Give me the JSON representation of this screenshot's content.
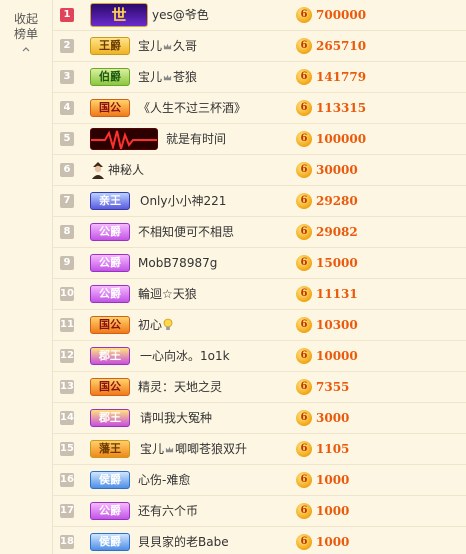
{
  "sidebar": {
    "collapse_label_1": "收起",
    "collapse_label_2": "榜单"
  },
  "rows": [
    {
      "rank": "1",
      "badge": "世",
      "name": "yes@爷色",
      "score": "700000"
    },
    {
      "rank": "2",
      "badge": "王爵",
      "name_a": "宝儿",
      "name_b": "久哥",
      "score": "265710"
    },
    {
      "rank": "3",
      "badge": "伯爵",
      "name_a": "宝儿",
      "name_b": "苍狼",
      "score": "141779"
    },
    {
      "rank": "4",
      "badge": "国公",
      "name": "《人生不过三杯酒》",
      "score": "113315"
    },
    {
      "rank": "5",
      "name": "就是有时间",
      "score": "100000"
    },
    {
      "rank": "6",
      "name": "神秘人",
      "score": "30000"
    },
    {
      "rank": "7",
      "badge": "亲王",
      "name": "Only小小神221",
      "score": "29280"
    },
    {
      "rank": "8",
      "badge": "公爵",
      "name": "不相知便可不相思",
      "score": "29082"
    },
    {
      "rank": "9",
      "badge": "公爵",
      "name": "MobB78987g",
      "score": "15000"
    },
    {
      "rank": "10",
      "badge": "公爵",
      "name": "輪迴☆天狼",
      "score": "11131"
    },
    {
      "rank": "11",
      "badge": "国公",
      "name": "初心",
      "score": "10300"
    },
    {
      "rank": "12",
      "badge": "郡王",
      "name": "一心向冰。1o1k",
      "score": "10000"
    },
    {
      "rank": "13",
      "badge": "国公",
      "name": "精灵：天地之灵",
      "score": "7355"
    },
    {
      "rank": "14",
      "badge": "郡王",
      "name": "请叫我大冤种",
      "score": "3000"
    },
    {
      "rank": "15",
      "badge": "藩王",
      "name_a": "宝儿",
      "name_b": "唧唧苍狼双升",
      "score": "1105"
    },
    {
      "rank": "16",
      "badge": "侯爵",
      "name": "心伤-难愈",
      "score": "1000"
    },
    {
      "rank": "17",
      "badge": "公爵",
      "name": "还有六个币",
      "score": "1000"
    },
    {
      "rank": "18",
      "badge": "侯爵",
      "name": "貝貝家的老Babe",
      "score": "1000"
    }
  ],
  "coin_glyph": "6",
  "colors": {
    "score": "#ea5a0c",
    "rank_top": "#e0435a",
    "rank_default": "#c9bfb0",
    "background": "#fdf6e3"
  },
  "icons": {
    "collapse": "chevron-up-icon",
    "coin": "coin-icon",
    "crown": "crown-icon",
    "mystery": "mystery-person-icon",
    "bulb": "lightbulb-icon"
  }
}
